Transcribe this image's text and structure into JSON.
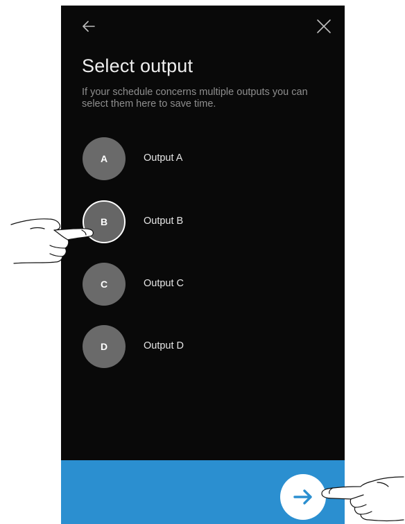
{
  "header": {
    "back_icon": "arrow-left-icon",
    "close_icon": "close-icon"
  },
  "title": "Select output",
  "subtitle": "If your schedule concerns multiple outputs you can select them here to save time.",
  "outputs": [
    {
      "letter": "A",
      "label": "Output A",
      "selected": false
    },
    {
      "letter": "B",
      "label": "Output B",
      "selected": true
    },
    {
      "letter": "C",
      "label": "Output C",
      "selected": false
    },
    {
      "letter": "D",
      "label": "Output D",
      "selected": false
    }
  ],
  "footer": {
    "next_icon": "arrow-right-icon"
  },
  "colors": {
    "background": "#090909",
    "accent": "#2b8fd0",
    "circle": "#6a6a6a",
    "arrow": "#2b8fd0"
  },
  "overlays": [
    "hand-pointer-icon",
    "hand-pointer-icon"
  ]
}
